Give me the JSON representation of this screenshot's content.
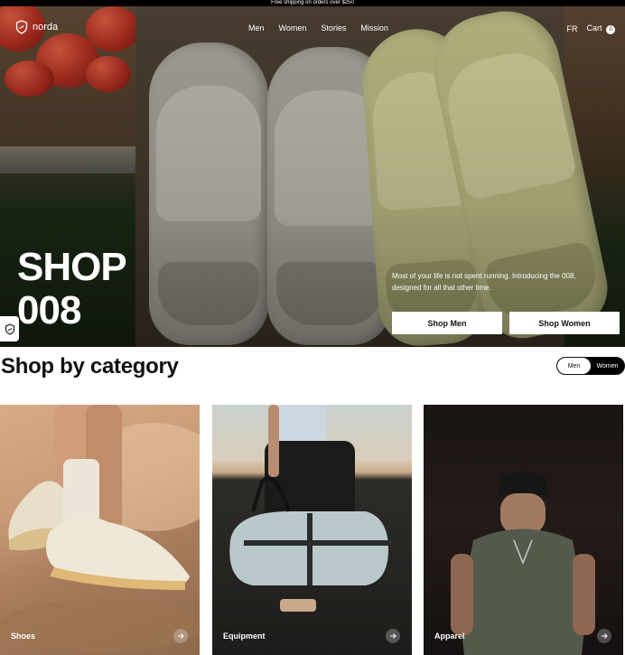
{
  "announcement": "Free shipping on orders over $250",
  "nav": {
    "brand": "norda",
    "links": [
      "Men",
      "Women",
      "Stories",
      "Mission"
    ],
    "language": "FR",
    "cart_label": "Cart",
    "cart_count": "0"
  },
  "hero": {
    "title_line1": "SHOP",
    "title_line2": "008",
    "copy": "Most of your life is not spent running. Introducing the 008, designed for all that other time.",
    "cta_men": "Shop Men",
    "cta_women": "Shop Women"
  },
  "categories": {
    "title": "Shop by category",
    "toggle": [
      "Men",
      "Women"
    ],
    "toggle_selected": "Men",
    "cards": [
      {
        "label": "Shoes"
      },
      {
        "label": "Equipment"
      },
      {
        "label": "Apparel"
      }
    ]
  },
  "colors": {
    "accent": "#000000",
    "background": "#ffffff"
  }
}
